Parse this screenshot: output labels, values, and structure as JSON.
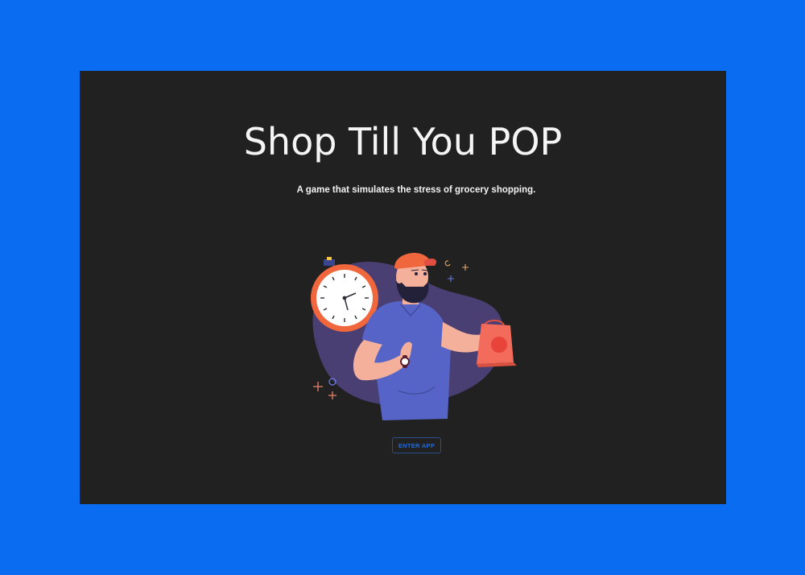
{
  "page": {
    "title": "Shop Till You POP",
    "subtitle": "A game that simulates the stress of grocery shopping.",
    "enter_button_label": "ENTER APP"
  },
  "illustration": {
    "icon": "shopper-with-stopwatch-illustration"
  },
  "colors": {
    "background_outer": "#0a6cf0",
    "panel": "#212121",
    "accent": "#1f6bde",
    "shirt": "#5664c8",
    "blob": "#4a3f73",
    "clock_ring": "#f0663d",
    "bag": "#f26b5b"
  }
}
